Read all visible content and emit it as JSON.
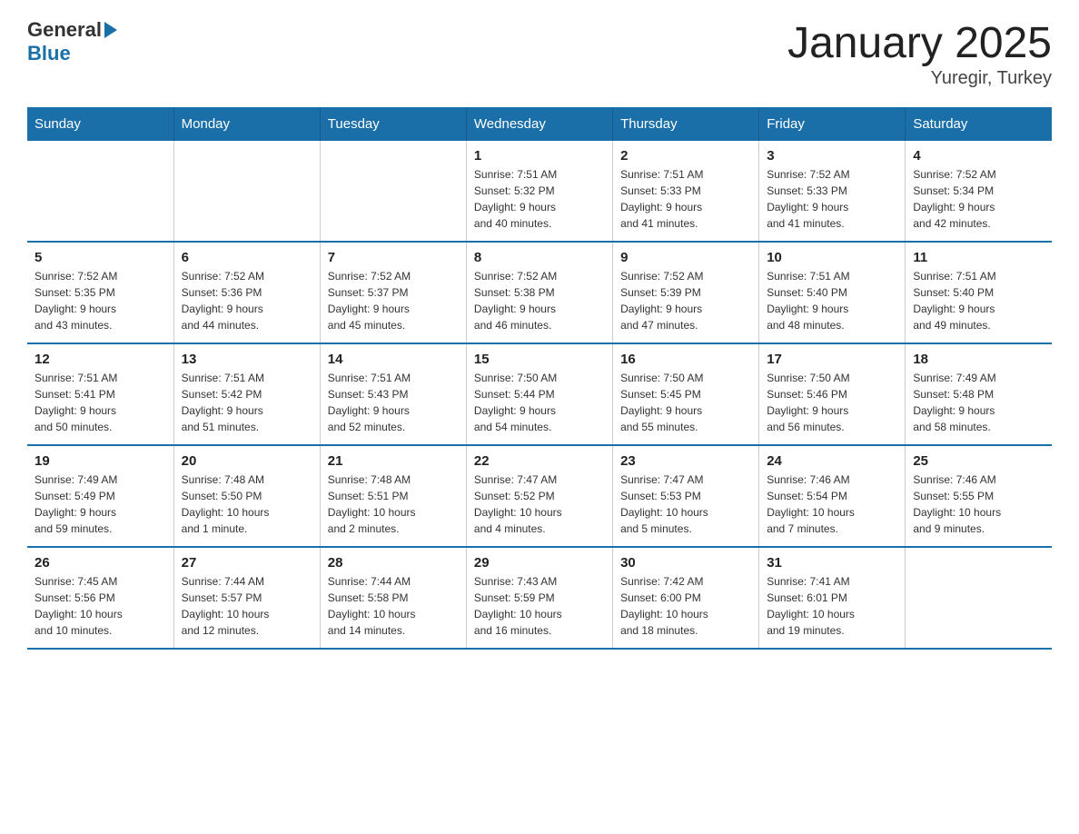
{
  "header": {
    "logo_general": "General",
    "logo_blue": "Blue",
    "title": "January 2025",
    "subtitle": "Yuregir, Turkey"
  },
  "weekdays": [
    "Sunday",
    "Monday",
    "Tuesday",
    "Wednesday",
    "Thursday",
    "Friday",
    "Saturday"
  ],
  "weeks": [
    [
      {
        "day": "",
        "info": ""
      },
      {
        "day": "",
        "info": ""
      },
      {
        "day": "",
        "info": ""
      },
      {
        "day": "1",
        "info": "Sunrise: 7:51 AM\nSunset: 5:32 PM\nDaylight: 9 hours\nand 40 minutes."
      },
      {
        "day": "2",
        "info": "Sunrise: 7:51 AM\nSunset: 5:33 PM\nDaylight: 9 hours\nand 41 minutes."
      },
      {
        "day": "3",
        "info": "Sunrise: 7:52 AM\nSunset: 5:33 PM\nDaylight: 9 hours\nand 41 minutes."
      },
      {
        "day": "4",
        "info": "Sunrise: 7:52 AM\nSunset: 5:34 PM\nDaylight: 9 hours\nand 42 minutes."
      }
    ],
    [
      {
        "day": "5",
        "info": "Sunrise: 7:52 AM\nSunset: 5:35 PM\nDaylight: 9 hours\nand 43 minutes."
      },
      {
        "day": "6",
        "info": "Sunrise: 7:52 AM\nSunset: 5:36 PM\nDaylight: 9 hours\nand 44 minutes."
      },
      {
        "day": "7",
        "info": "Sunrise: 7:52 AM\nSunset: 5:37 PM\nDaylight: 9 hours\nand 45 minutes."
      },
      {
        "day": "8",
        "info": "Sunrise: 7:52 AM\nSunset: 5:38 PM\nDaylight: 9 hours\nand 46 minutes."
      },
      {
        "day": "9",
        "info": "Sunrise: 7:52 AM\nSunset: 5:39 PM\nDaylight: 9 hours\nand 47 minutes."
      },
      {
        "day": "10",
        "info": "Sunrise: 7:51 AM\nSunset: 5:40 PM\nDaylight: 9 hours\nand 48 minutes."
      },
      {
        "day": "11",
        "info": "Sunrise: 7:51 AM\nSunset: 5:40 PM\nDaylight: 9 hours\nand 49 minutes."
      }
    ],
    [
      {
        "day": "12",
        "info": "Sunrise: 7:51 AM\nSunset: 5:41 PM\nDaylight: 9 hours\nand 50 minutes."
      },
      {
        "day": "13",
        "info": "Sunrise: 7:51 AM\nSunset: 5:42 PM\nDaylight: 9 hours\nand 51 minutes."
      },
      {
        "day": "14",
        "info": "Sunrise: 7:51 AM\nSunset: 5:43 PM\nDaylight: 9 hours\nand 52 minutes."
      },
      {
        "day": "15",
        "info": "Sunrise: 7:50 AM\nSunset: 5:44 PM\nDaylight: 9 hours\nand 54 minutes."
      },
      {
        "day": "16",
        "info": "Sunrise: 7:50 AM\nSunset: 5:45 PM\nDaylight: 9 hours\nand 55 minutes."
      },
      {
        "day": "17",
        "info": "Sunrise: 7:50 AM\nSunset: 5:46 PM\nDaylight: 9 hours\nand 56 minutes."
      },
      {
        "day": "18",
        "info": "Sunrise: 7:49 AM\nSunset: 5:48 PM\nDaylight: 9 hours\nand 58 minutes."
      }
    ],
    [
      {
        "day": "19",
        "info": "Sunrise: 7:49 AM\nSunset: 5:49 PM\nDaylight: 9 hours\nand 59 minutes."
      },
      {
        "day": "20",
        "info": "Sunrise: 7:48 AM\nSunset: 5:50 PM\nDaylight: 10 hours\nand 1 minute."
      },
      {
        "day": "21",
        "info": "Sunrise: 7:48 AM\nSunset: 5:51 PM\nDaylight: 10 hours\nand 2 minutes."
      },
      {
        "day": "22",
        "info": "Sunrise: 7:47 AM\nSunset: 5:52 PM\nDaylight: 10 hours\nand 4 minutes."
      },
      {
        "day": "23",
        "info": "Sunrise: 7:47 AM\nSunset: 5:53 PM\nDaylight: 10 hours\nand 5 minutes."
      },
      {
        "day": "24",
        "info": "Sunrise: 7:46 AM\nSunset: 5:54 PM\nDaylight: 10 hours\nand 7 minutes."
      },
      {
        "day": "25",
        "info": "Sunrise: 7:46 AM\nSunset: 5:55 PM\nDaylight: 10 hours\nand 9 minutes."
      }
    ],
    [
      {
        "day": "26",
        "info": "Sunrise: 7:45 AM\nSunset: 5:56 PM\nDaylight: 10 hours\nand 10 minutes."
      },
      {
        "day": "27",
        "info": "Sunrise: 7:44 AM\nSunset: 5:57 PM\nDaylight: 10 hours\nand 12 minutes."
      },
      {
        "day": "28",
        "info": "Sunrise: 7:44 AM\nSunset: 5:58 PM\nDaylight: 10 hours\nand 14 minutes."
      },
      {
        "day": "29",
        "info": "Sunrise: 7:43 AM\nSunset: 5:59 PM\nDaylight: 10 hours\nand 16 minutes."
      },
      {
        "day": "30",
        "info": "Sunrise: 7:42 AM\nSunset: 6:00 PM\nDaylight: 10 hours\nand 18 minutes."
      },
      {
        "day": "31",
        "info": "Sunrise: 7:41 AM\nSunset: 6:01 PM\nDaylight: 10 hours\nand 19 minutes."
      },
      {
        "day": "",
        "info": ""
      }
    ]
  ]
}
